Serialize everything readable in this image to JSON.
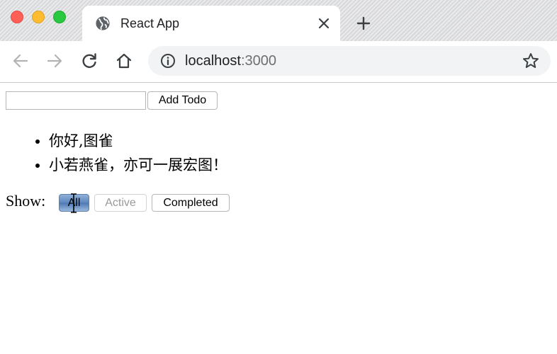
{
  "browser": {
    "tab": {
      "title": "React App",
      "icon": "globe-icon",
      "close_icon": "close-icon"
    },
    "new_tab_icon": "plus-icon",
    "toolbar": {
      "back_icon": "arrow-left-icon",
      "forward_icon": "arrow-right-icon",
      "reload_icon": "reload-icon",
      "home_icon": "home-icon",
      "url_host": "localhost",
      "url_port": ":3000",
      "bookmark_icon": "star-icon"
    },
    "window_controls": {
      "close_color": "#fe5f57",
      "minimize_color": "#febc2e",
      "zoom_color": "#28c840"
    }
  },
  "app": {
    "input": {
      "value": "",
      "placeholder": ""
    },
    "add_button_label": "Add Todo",
    "todos": [
      {
        "text": "你好,图雀"
      },
      {
        "text": "小若燕雀，亦可一展宏图！"
      }
    ],
    "filter": {
      "label": "Show:",
      "buttons": [
        {
          "label": "All",
          "state": "pressed"
        },
        {
          "label": "Active",
          "state": "disabled"
        },
        {
          "label": "Completed",
          "state": "normal"
        }
      ]
    }
  }
}
